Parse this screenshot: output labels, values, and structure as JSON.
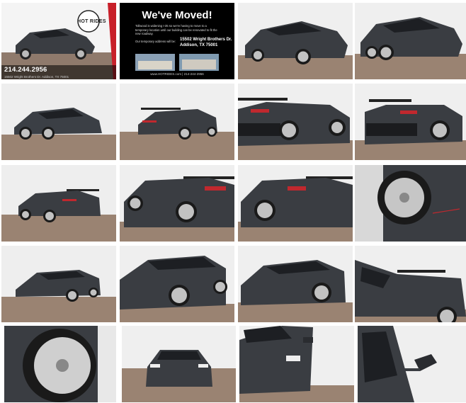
{
  "gallery": {
    "dealer_tile": {
      "logo_text": "HOT RIDES",
      "phone": "214.244.2956",
      "address_line": "15502 Wright Brothers Dr. Addison, TX 75001"
    },
    "moved_tile": {
      "headline": "We've Moved!",
      "paragraph_1": "Tollwood is widening I-35 so we're having to move to a temporary location until our building can be renovated to fit the new roadway.",
      "paragraph_2": "Our temporary address will be:",
      "new_address": "15502 Wright Brothers Dr. Addison, TX 75001",
      "footer": "www.HOTRIDES.com | 214-244-2956"
    },
    "accent_colors": {
      "car_body": "#3a3d42",
      "floor": "#9a8372",
      "studio_wall": "#eeeeee",
      "dealer_red": "#c8202a"
    }
  }
}
